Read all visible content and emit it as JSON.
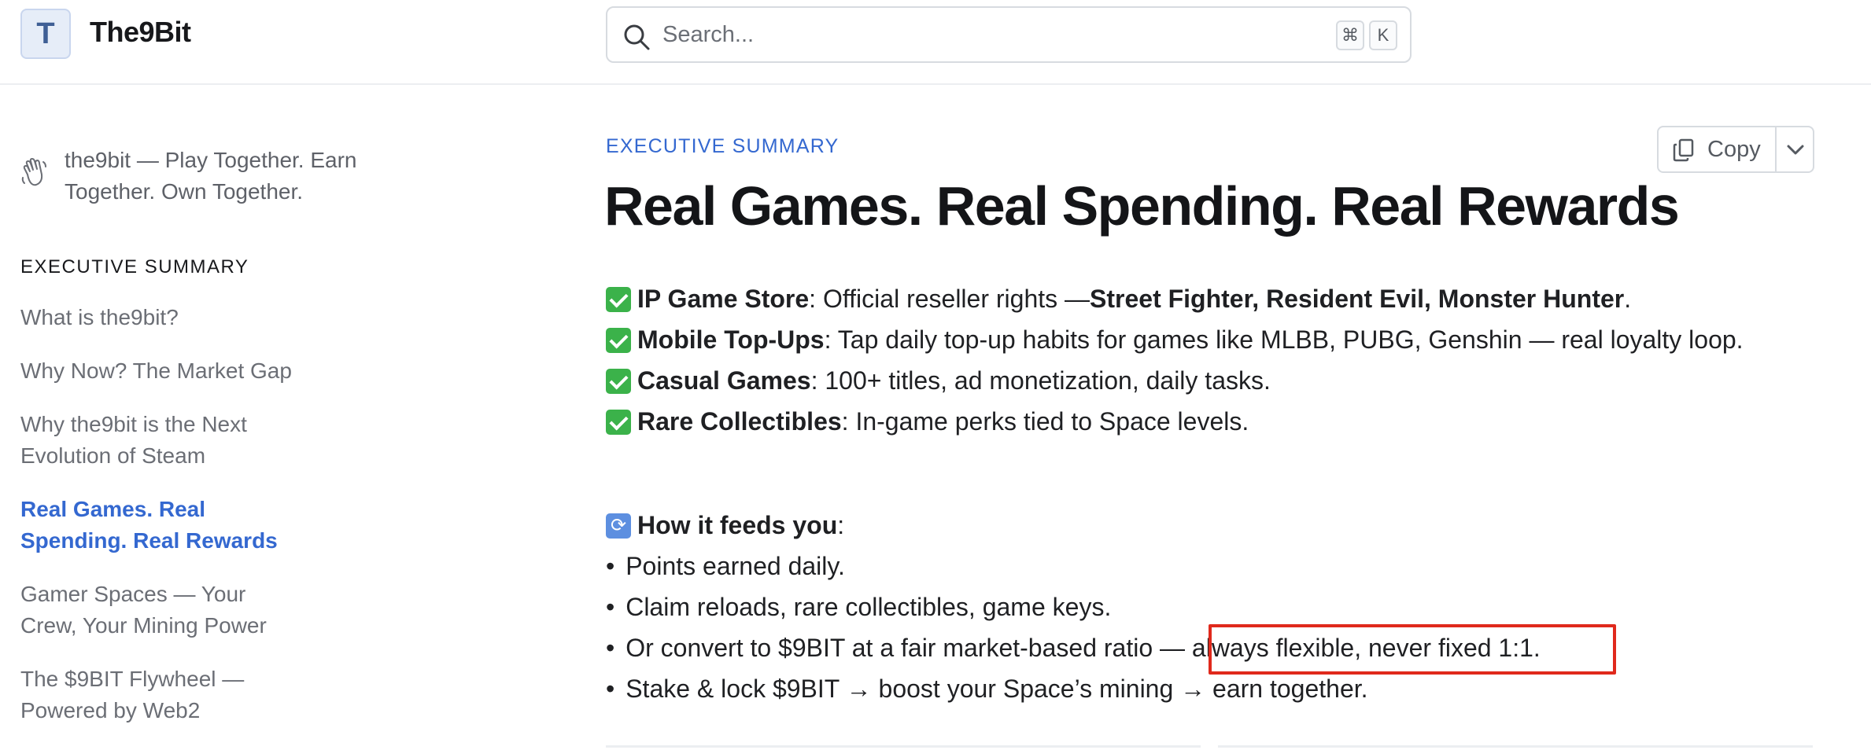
{
  "header": {
    "logo_letter": "T",
    "brand": "The9Bit",
    "search": {
      "placeholder": "Search...",
      "shortcut_cmd": "⌘",
      "shortcut_key": "K"
    }
  },
  "sidebar": {
    "top_link": "the9bit — Play Together. Earn Together. Own Together.",
    "section_title": "EXECUTIVE SUMMARY",
    "items": [
      {
        "label": "What is the9bit?",
        "active": false
      },
      {
        "label": "Why Now? The Market Gap",
        "active": false
      },
      {
        "label": "Why the9bit is the Next Evolution of Steam",
        "active": false
      },
      {
        "label": "Real Games. Real Spending. Real Rewards",
        "active": true
      },
      {
        "label": "Gamer Spaces — Your Crew, Your Mining Power",
        "active": false
      },
      {
        "label": "The $9BIT Flywheel — Powered by Web2",
        "active": false
      }
    ]
  },
  "main": {
    "eyebrow": "EXECUTIVE SUMMARY",
    "copy_label": "Copy",
    "title": "Real Games. Real Spending. Real Rewards",
    "features": [
      {
        "bold": "IP Game Store",
        "text": ": Official reseller rights — ",
        "bold2": "Street Fighter, Resident Evil, Monster Hunter",
        "tail": "."
      },
      {
        "bold": "Mobile Top-Ups",
        "text": ": Tap daily top-up habits for games like MLBB, PUBG, Genshin — real loyalty loop."
      },
      {
        "bold": "Casual Games",
        "text": ": 100+ titles, ad monetization, daily tasks."
      },
      {
        "bold": "Rare Collectibles",
        "text": ": In-game perks tied to Space levels."
      }
    ],
    "feeds_heading": "How it feeds you",
    "feeds_colon": ":",
    "bullet_char": "•",
    "feeds": [
      "Points earned daily.",
      "Claim reloads, rare collectibles, game keys.",
      "Or convert to $9BIT at a fair market-based ratio — always flexible, never fixed 1:1.",
      "Stake & lock $9BIT → boost your Space’s mining → earn together."
    ]
  },
  "colors": {
    "accent": "#3468d0",
    "check_green": "#3bb24a",
    "highlight_red": "#e0291c"
  },
  "icons": [
    "search-icon",
    "wave-icon",
    "copy-icon",
    "chevron-down-icon",
    "check-icon",
    "repeat-icon"
  ]
}
